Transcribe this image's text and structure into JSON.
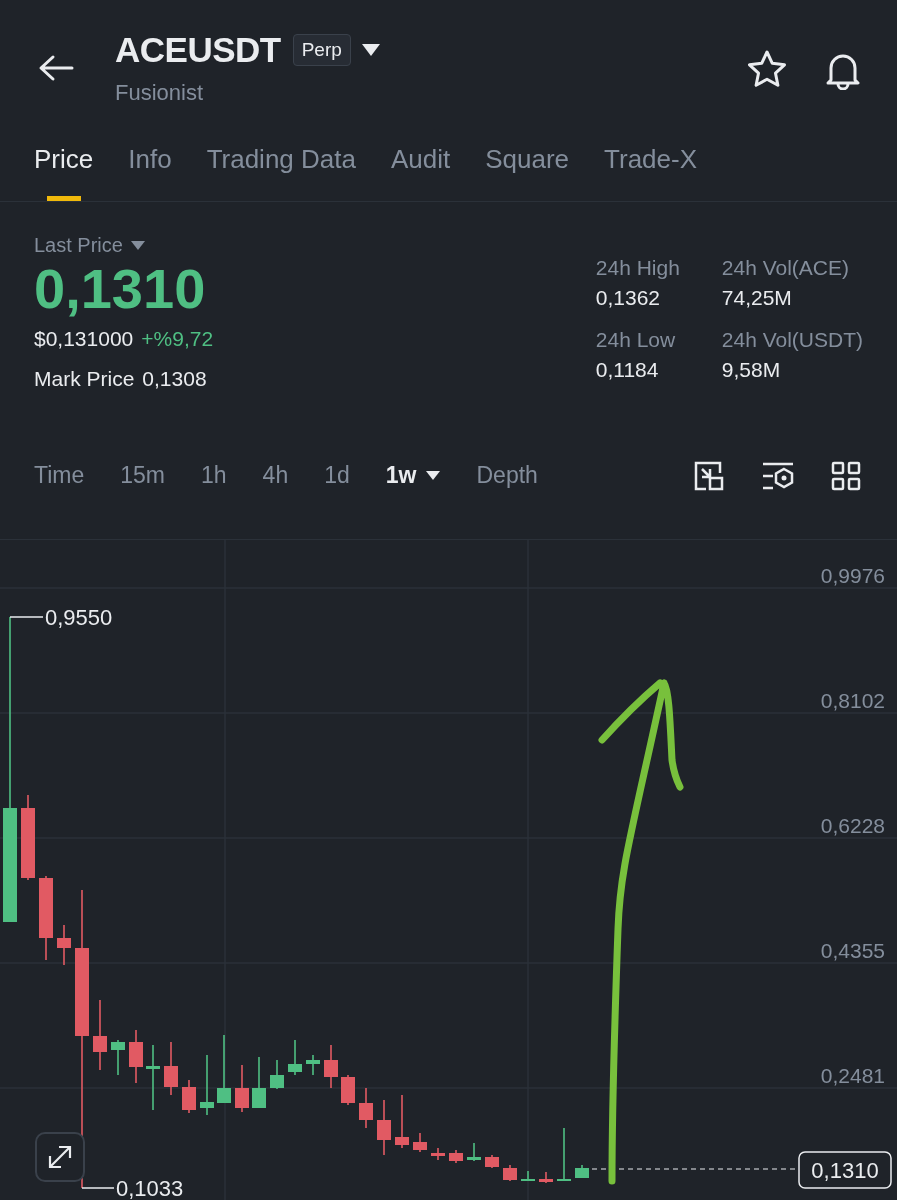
{
  "header": {
    "title": "ACEUSDT",
    "badge": "Perp",
    "subtitle": "Fusionist"
  },
  "tabs": [
    {
      "label": "Price",
      "selected": true
    },
    {
      "label": "Info",
      "selected": false
    },
    {
      "label": "Trading Data",
      "selected": false
    },
    {
      "label": "Audit",
      "selected": false
    },
    {
      "label": "Square",
      "selected": false
    },
    {
      "label": "Trade-X",
      "selected": false
    }
  ],
  "last_price": {
    "label": "Last Price",
    "value": "0,1310",
    "usd_value": "$0,131000",
    "change": "+%9,72",
    "mark_price_label": "Mark Price",
    "mark_price_value": "0,1308"
  },
  "stats": [
    {
      "label": "24h High",
      "value": "0,1362"
    },
    {
      "label": "24h Vol(ACE)",
      "value": "74,25M"
    },
    {
      "label": "24h Low",
      "value": "0,1184"
    },
    {
      "label": "24h Vol(USDT)",
      "value": "9,58M"
    }
  ],
  "intervals": [
    {
      "label": "Time",
      "selected": false,
      "kind": "plain"
    },
    {
      "label": "15m",
      "selected": false,
      "kind": "plain"
    },
    {
      "label": "1h",
      "selected": false,
      "kind": "plain"
    },
    {
      "label": "4h",
      "selected": false,
      "kind": "plain"
    },
    {
      "label": "1d",
      "selected": false,
      "kind": "plain"
    },
    {
      "label": "1w",
      "selected": true,
      "kind": "dropdown"
    },
    {
      "label": "Depth",
      "selected": false,
      "kind": "plain"
    }
  ],
  "chart": {
    "y_ticks": [
      "0,9976",
      "0,8102",
      "0,6228",
      "0,4355",
      "0,2481"
    ],
    "high_label": "0,9550",
    "low_label": "0,1033",
    "current_price": "0,1310"
  }
}
